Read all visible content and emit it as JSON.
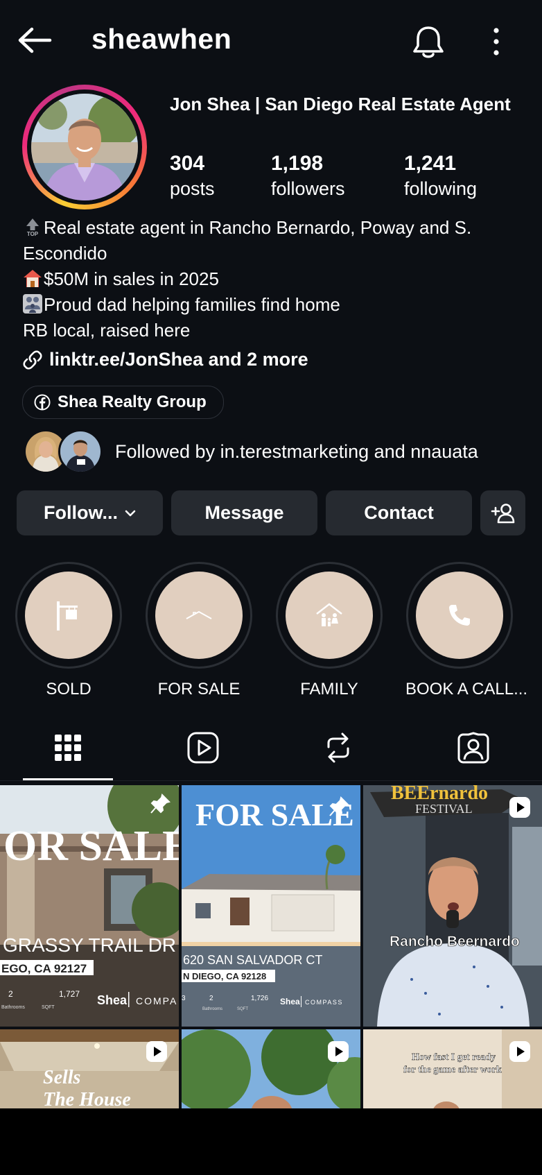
{
  "header": {
    "username": "sheawhen"
  },
  "profile": {
    "display_name": "Jon Shea | San Diego Real Estate Agent",
    "stats": [
      {
        "num": "304",
        "label": "posts"
      },
      {
        "num": "1,198",
        "label": "followers"
      },
      {
        "num": "1,241",
        "label": "following"
      }
    ],
    "bio": [
      "Real estate agent in Rancho Bernardo, Poway and S.",
      "Escondido",
      "$50M in sales in 2025",
      "Proud dad helping families find home",
      "RB local, raised here"
    ],
    "link_text": "linktr.ee/JonShea and 2 more",
    "facebook_chip": "Shea Realty Group",
    "followed_by": "Followed by in.terestmarketing and nnauata"
  },
  "buttons": {
    "follow": "Follow...",
    "message": "Message",
    "contact": "Contact"
  },
  "highlights": [
    {
      "label": "SOLD",
      "icon": "sign-icon"
    },
    {
      "label": "FOR SALE",
      "icon": "roof-icon"
    },
    {
      "label": "FAMILY",
      "icon": "family-house-icon"
    },
    {
      "label": "BOOK A CALL...",
      "icon": "phone-icon"
    }
  ],
  "tabs": [
    "grid-icon",
    "reels-icon",
    "reposts-icon",
    "tagged-icon"
  ],
  "posts": {
    "p1": {
      "headline": "OR SALE",
      "street": "GRASSY TRAIL DR",
      "city": "EGO, CA 92127",
      "baths": "2",
      "sqft": "1,727",
      "baths_lbl": "Bathrooms",
      "sqft_lbl": "SQFT",
      "brand": "Shea",
      "brand2": "COMPA"
    },
    "p2": {
      "headline": "FOR SALE",
      "street": "620 SAN SALVADOR CT",
      "city": "N DIEGO, CA 92128",
      "beds": "3",
      "baths": "2",
      "sqft": "1,726",
      "baths_lbl": "Bathrooms",
      "sqft_lbl": "SQFT",
      "brand": "Shea",
      "brand2": "COMPASS"
    },
    "p3": {
      "banner": "BEErnardo",
      "banner2": "FESTIVAL",
      "caption": "Rancho Beernardo"
    },
    "p4": {
      "caption1": "Sells",
      "caption2": "The House"
    },
    "p6": {
      "caption1": "How fast I get ready",
      "caption2": "for the game after work"
    }
  },
  "colors": {
    "background": "#0c0f14",
    "button": "#262a30",
    "highlight_fill": "#e1cfbf"
  }
}
